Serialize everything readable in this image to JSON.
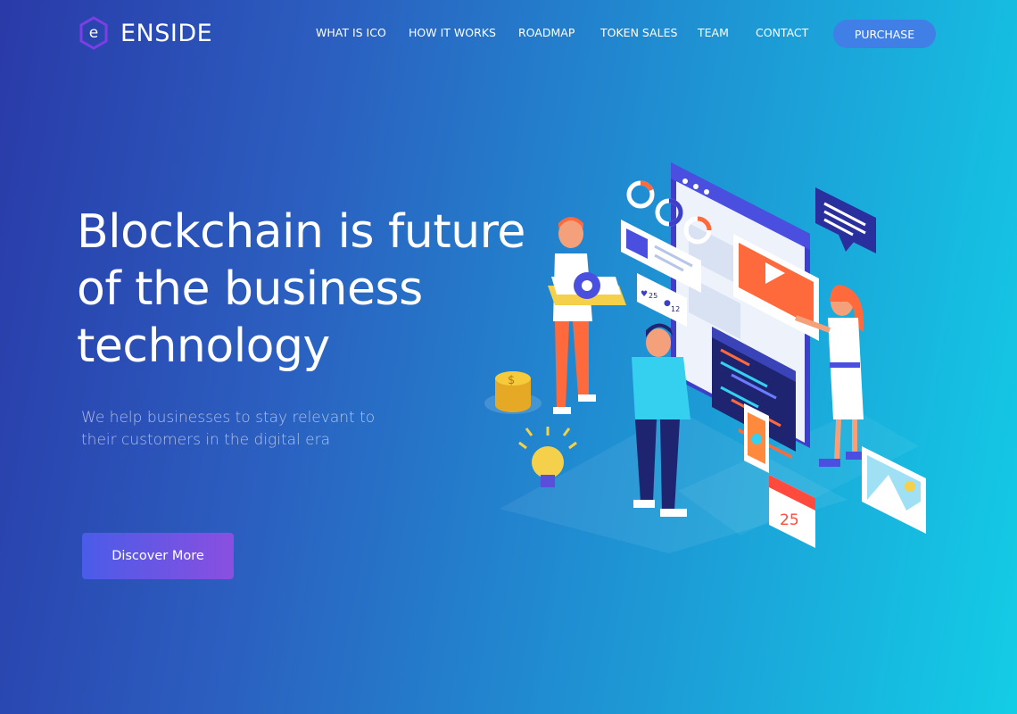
{
  "brand": {
    "logo_letter": "e",
    "name": "ENSIDE"
  },
  "nav": {
    "items": [
      {
        "label": "WHAT IS ICO"
      },
      {
        "label": "HOW IT WORKS"
      },
      {
        "label": "ROADMAP"
      },
      {
        "label": "TOKEN SALES"
      },
      {
        "label": "TEAM"
      },
      {
        "label": "CONTACT"
      }
    ],
    "purchase_label": "PURCHASE"
  },
  "hero": {
    "title_line1": "Blockchain is future",
    "title_line2": "of the business",
    "title_line3": "technology",
    "subtitle_line1": "We help businesses to stay relevant to",
    "subtitle_line2": "their customers in the digital era",
    "cta_label": "Discover More"
  },
  "illustration": {
    "likes": "25",
    "comments": "12",
    "calendar_day": "25",
    "coin_symbol": "$"
  },
  "colors": {
    "accent_button": "#3f7fe6",
    "cta_gradient_start": "#4a5ce8",
    "cta_gradient_end": "#8a4fe0",
    "logo_hex": "#7b3fe4"
  }
}
